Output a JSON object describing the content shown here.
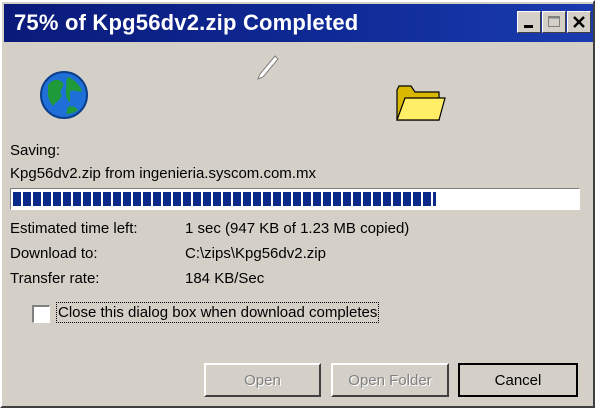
{
  "window": {
    "title": "75% of Kpg56dv2.zip Completed",
    "titlebar_colors": [
      "#0a1a7a",
      "#1a3bb0"
    ]
  },
  "status": {
    "saving_label": "Saving:",
    "source": "Kpg56dv2.zip from ingenieria.syscom.com.mx",
    "progress_fraction": 0.75
  },
  "details": {
    "estimated_label": "Estimated time left:",
    "estimated_value": "1 sec (947 KB of 1.23 MB copied)",
    "download_to_label": "Download to:",
    "download_to_value": "C:\\zips\\Kpg56dv2.zip",
    "transfer_rate_label": "Transfer rate:",
    "transfer_rate_value": "184 KB/Sec"
  },
  "options": {
    "close_when_done_label": "Close this dialog box when download completes",
    "close_when_done_checked": false
  },
  "buttons": {
    "open": "Open",
    "open_folder": "Open Folder",
    "cancel": "Cancel"
  },
  "icons": {
    "globe": "globe-icon",
    "paper": "flying-paper-icon",
    "folder": "folder-icon"
  }
}
